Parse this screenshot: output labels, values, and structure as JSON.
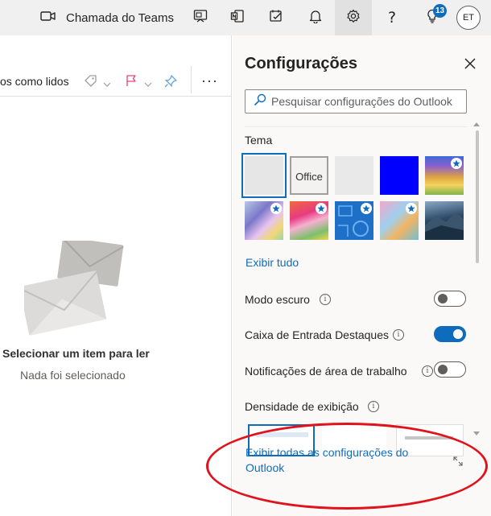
{
  "topbar": {
    "teams_call_label": "Chamada do Teams",
    "icons": [
      "video-icon",
      "whiteboard-icon",
      "onenote-icon",
      "todo-icon",
      "bell-icon",
      "gear-icon",
      "help-icon",
      "lightbulb-icon"
    ],
    "tips_badge": "13",
    "avatar_initials": "ET",
    "accent": "#0f6cbd"
  },
  "reading_pane": {
    "toolbar": {
      "mark_read_label": "os como lidos",
      "more_label": "···"
    },
    "empty_state": {
      "title": "Selecionar um item para ler",
      "subtitle": "Nada foi selecionado"
    }
  },
  "settings": {
    "title": "Configurações",
    "search_placeholder": "Pesquisar configurações do Outlook",
    "theme_section": {
      "label": "Tema",
      "office_label": "Office",
      "view_all": "Exibir tudo"
    },
    "dark_mode": {
      "label": "Modo escuro",
      "enabled": false
    },
    "focused_inbox": {
      "label": "Caixa de Entrada Destaques",
      "enabled": true
    },
    "desktop_notifications": {
      "label": "Notificações de área de trabalho",
      "enabled": false
    },
    "density": {
      "label": "Densidade de exibição"
    },
    "view_all_settings": "Exibir todas as configurações do Outlook"
  }
}
